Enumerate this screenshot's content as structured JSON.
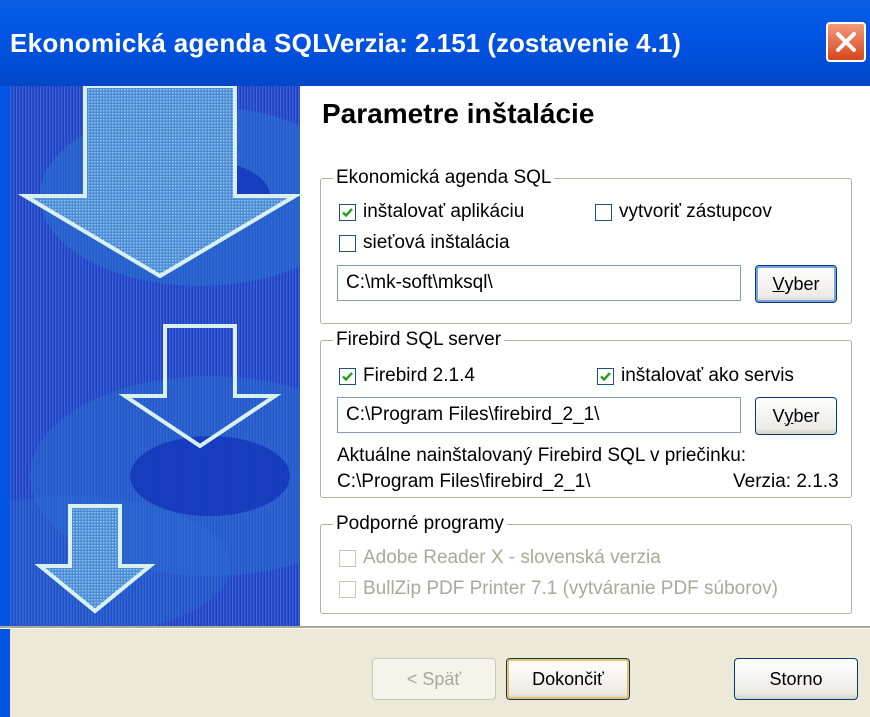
{
  "window": {
    "app_title": "Ekonomická agenda SQL",
    "version_title": "Verzia: 2.151 (zostavenie 4.1)"
  },
  "page": {
    "heading": "Parametre inštalácie"
  },
  "app_group": {
    "title": "Ekonomická agenda SQL",
    "install_app": {
      "label": "inštalovať aplikáciu",
      "checked": true
    },
    "create_shortcuts": {
      "label": "vytvoriť zástupcov",
      "checked": false
    },
    "network_install": {
      "label": "sieťová inštalácia",
      "checked": false
    },
    "path": "C:\\mk-soft\\mksql\\",
    "browse_label_prefix": "",
    "browse_label_u": "V",
    "browse_label_rest": "yber"
  },
  "firebird_group": {
    "title": "Firebird SQL server",
    "firebird": {
      "label": "Firebird 2.1.4",
      "checked": true
    },
    "as_service": {
      "label": "inštalovať ako servis",
      "checked": true
    },
    "path": "C:\\Program Files\\firebird_2_1\\",
    "browse_label_prefix": "V",
    "browse_label_u": "y",
    "browse_label_rest": "ber",
    "installed_info": "Aktuálne nainštalovaný Firebird SQL v priečinku:",
    "installed_path": "C:\\Program Files\\firebird_2_1\\",
    "installed_version": "Verzia: 2.1.3"
  },
  "support_group": {
    "title": "Podporné programy",
    "adobe": {
      "label": "Adobe Reader X  - slovenská verzia",
      "checked": false
    },
    "bullzip": {
      "label": "BullZip PDF Printer 7.1 (vytváranie PDF súborov)",
      "checked": false
    }
  },
  "footer": {
    "back": "< Späť",
    "finish": "Dokončiť",
    "cancel": "Storno"
  },
  "colors": {
    "title_bar": "#0055e5",
    "side_panel": "#0e2fb6",
    "close": "#d6451e"
  }
}
